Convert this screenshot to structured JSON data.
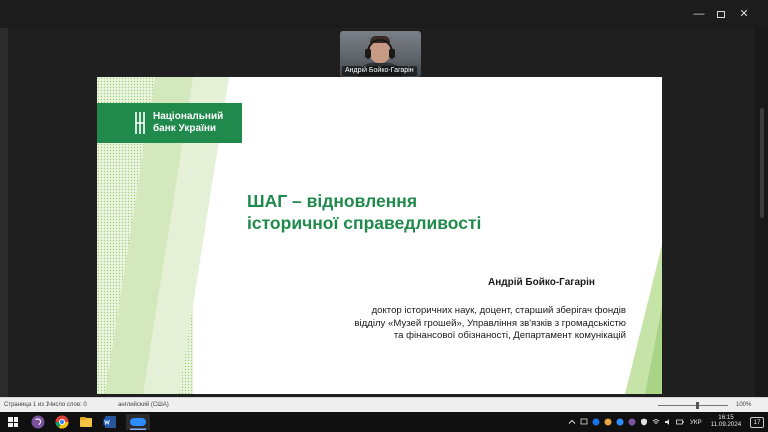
{
  "window": {
    "minimize_glyph": "—",
    "close_glyph": "✕"
  },
  "participant": {
    "name": "Андрій Бойко-Гагарін"
  },
  "slide": {
    "logo_line1": "Національний",
    "logo_line2": "банк України",
    "title_line1": "ШАГ – відновлення",
    "title_line2": "історичної справедливості",
    "speaker_name": "Андрій Бойко-Гагарін",
    "desc_line1": "доктор історичних наук, доцент, старший зберігач фондів",
    "desc_line2": "відділу «Музей грошей», Управління зв'язків з громадськістю",
    "desc_line3": "та фінансової обізнаності, Департамент комунікацій",
    "colors": {
      "brand_green": "#1f8a4c",
      "light_green": "#c6e3a8"
    }
  },
  "statusbar": {
    "page": "Страница 1 из 1",
    "words": "Число слов: 0",
    "language": "английский (США)",
    "zoom": "100%"
  },
  "taskbar": {
    "language": "УКР",
    "time": "16:15",
    "date": "11.09.2024",
    "notification_count": "17",
    "apps": [
      "windows-start-icon",
      "viber-icon",
      "chrome-icon",
      "file-explorer-icon",
      "word-icon",
      "zoom-icon"
    ]
  }
}
